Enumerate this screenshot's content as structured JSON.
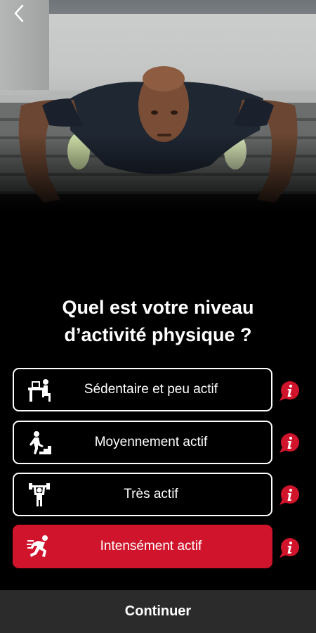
{
  "hero": {
    "image": "man-doing-push-up-photo"
  },
  "nav": {
    "back_icon": "chevron-left-icon"
  },
  "question": {
    "line1": "Quel est votre niveau",
    "line2": "d’activité physique ?"
  },
  "options": [
    {
      "label": "Sédentaire et peu actif",
      "icon": "desk-worker-icon",
      "selected": false
    },
    {
      "label": "Moyennement actif",
      "icon": "stairs-walker-icon",
      "selected": false
    },
    {
      "label": "Très actif",
      "icon": "weightlifter-icon",
      "selected": false
    },
    {
      "label": "Intensément actif",
      "icon": "runner-icon",
      "selected": true
    }
  ],
  "info_icon": "info-bubble-icon",
  "footer": {
    "continue_label": "Continuer"
  },
  "colors": {
    "accent": "#d0142c",
    "background": "#000000",
    "footer": "#2b2b2b",
    "text": "#ffffff"
  }
}
